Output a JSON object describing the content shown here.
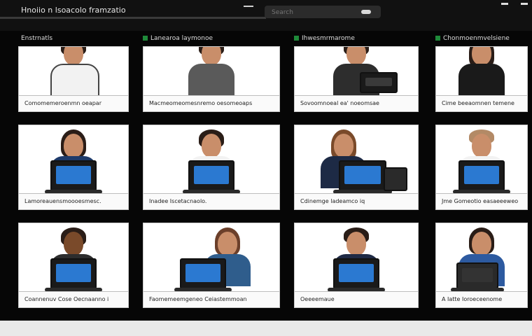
{
  "window": {
    "title": "Hnoiio n lsoacolo framzatio",
    "search_placeholder": "Search"
  },
  "colors": {
    "accent_green": "#1f8a3a",
    "screen_blue": "#2b79d1",
    "background": "#060606"
  },
  "participants": [
    {
      "header": "Enstrnatls",
      "caption": "Comomemeroenmn oeapar"
    },
    {
      "header": "Lanearoa laymonoe",
      "caption": "Macmeomeomesnremo oesomeoaps"
    },
    {
      "header": "Ihwesmrmarome",
      "caption": "Sovoomnoeal ea' noeomsae"
    },
    {
      "header": "Chonmoenmvelsiene",
      "caption": "Cime beeaomnen temene"
    },
    {
      "header": "",
      "caption": "Lamoreauensmoooesmesc."
    },
    {
      "header": "",
      "caption": "Inadee Iscetacnaolo."
    },
    {
      "header": "",
      "caption": "Cdinemge ladeamco iq"
    },
    {
      "header": "",
      "caption": "Jme Gomeotio easaeeeweo"
    },
    {
      "header": "",
      "caption": "Coannenuv Cose Oecnaanno i"
    },
    {
      "header": "",
      "caption": "Faomemeemgeneo Ceiastemmoan"
    },
    {
      "header": "",
      "caption": "Oeeeemaue"
    },
    {
      "header": "",
      "caption": "A Iatte Ioroeceenome"
    }
  ]
}
